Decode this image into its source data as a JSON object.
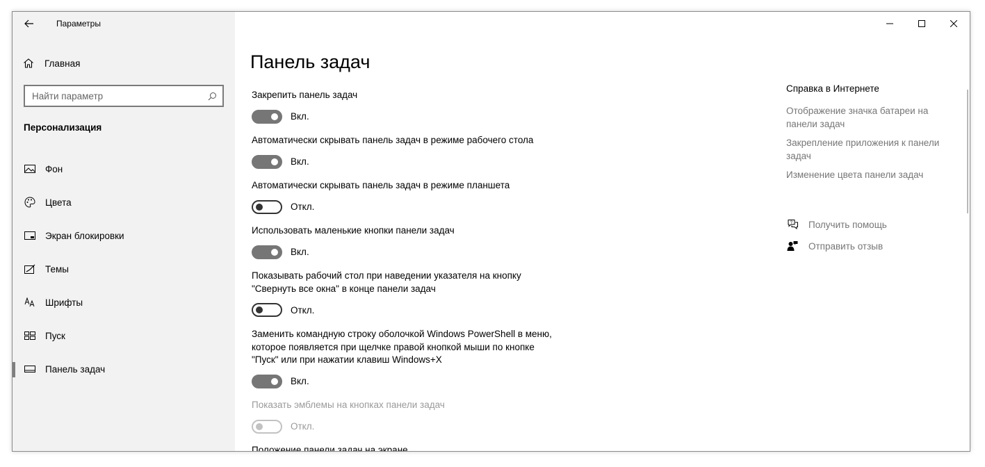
{
  "window": {
    "app_title": "Параметры"
  },
  "nav": {
    "home_label": "Главная",
    "search_placeholder": "Найти параметр",
    "section_heading": "Персонализация",
    "items": [
      {
        "label": "Фон",
        "icon": "picture-icon"
      },
      {
        "label": "Цвета",
        "icon": "palette-icon"
      },
      {
        "label": "Экран блокировки",
        "icon": "lock-screen-icon"
      },
      {
        "label": "Темы",
        "icon": "brush-icon"
      },
      {
        "label": "Шрифты",
        "icon": "font-icon"
      },
      {
        "label": "Пуск",
        "icon": "start-icon"
      },
      {
        "label": "Панель задач",
        "icon": "taskbar-icon",
        "selected": true
      }
    ]
  },
  "main": {
    "title": "Панель задач",
    "settings": [
      {
        "label": "Закрепить панель задач",
        "state": "Вкл.",
        "on": true
      },
      {
        "label": "Автоматически скрывать панель задач в режиме рабочего стола",
        "state": "Вкл.",
        "on": true
      },
      {
        "label": "Автоматически скрывать панель задач в режиме планшета",
        "state": "Откл.",
        "on": false
      },
      {
        "label": "Использовать маленькие кнопки панели задач",
        "state": "Вкл.",
        "on": true
      },
      {
        "label": "Показывать рабочий стол при наведении указателя на кнопку \"Свернуть все окна\" в конце панели задач",
        "state": "Откл.",
        "on": false
      },
      {
        "label": "Заменить командную строку оболочкой Windows PowerShell в меню, которое появляется при щелчке правой кнопкой мыши по кнопке \"Пуск\" или при нажатии клавиш Windows+X",
        "state": "Вкл.",
        "on": true
      },
      {
        "label": "Показать эмблемы на кнопках панели задач",
        "state": "Откл.",
        "on": false,
        "disabled": true
      }
    ],
    "partial_heading": "Положение панели задач на экране"
  },
  "help": {
    "title": "Справка в Интернете",
    "links": [
      "Отображение значка батареи на панели задач",
      "Закрепление приложения к панели задач",
      "Изменение цвета панели задач"
    ],
    "get_help": "Получить помощь",
    "feedback": "Отправить отзыв"
  },
  "colors": {
    "nav_bg": "#f2f2f2",
    "toggle_on": "#767676",
    "link_gray": "#767676"
  }
}
